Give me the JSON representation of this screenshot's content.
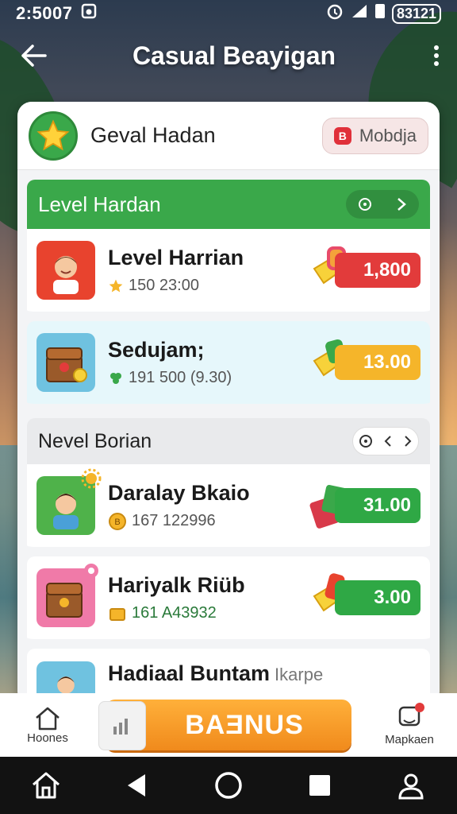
{
  "status_bar": {
    "time": "2:5007",
    "battery": "83121"
  },
  "header": {
    "title": "Casual Beayigan"
  },
  "profile": {
    "name": "Geval Hadan",
    "mode_label": "Mobdja",
    "mode_icon": "B"
  },
  "section1": {
    "title": "Level Hardan",
    "items": [
      {
        "title": "Level Harrian",
        "sub": "150 23:00",
        "price": "1,800",
        "price_color": "#e23b3b"
      },
      {
        "title": "Sedujam;",
        "sub": "191 500 (9.30)",
        "price": "13.00",
        "price_color": "#f5b52a"
      }
    ]
  },
  "section2": {
    "title": "Nevel Borian",
    "items": [
      {
        "title": "Daralay Bkaio",
        "sub": "167 122996",
        "price": "31.00",
        "price_color": "#2fa845"
      },
      {
        "title": "Hariyalk Riüb",
        "sub": "161 A43932",
        "price": "3.00",
        "price_color": "#2fa845"
      },
      {
        "title": "Hadiaal Buntam",
        "sub": "Ikarpe",
        "price": "",
        "price_color": "#2fa845"
      }
    ]
  },
  "bottom_nav": {
    "home_label": "Hoones",
    "bonus_label": "BAƎNUS",
    "messages_label": "Mapkaen"
  },
  "icons": {
    "back": "arrow-left",
    "more": "more-vertical",
    "star": "star",
    "home": "home",
    "message": "message"
  }
}
